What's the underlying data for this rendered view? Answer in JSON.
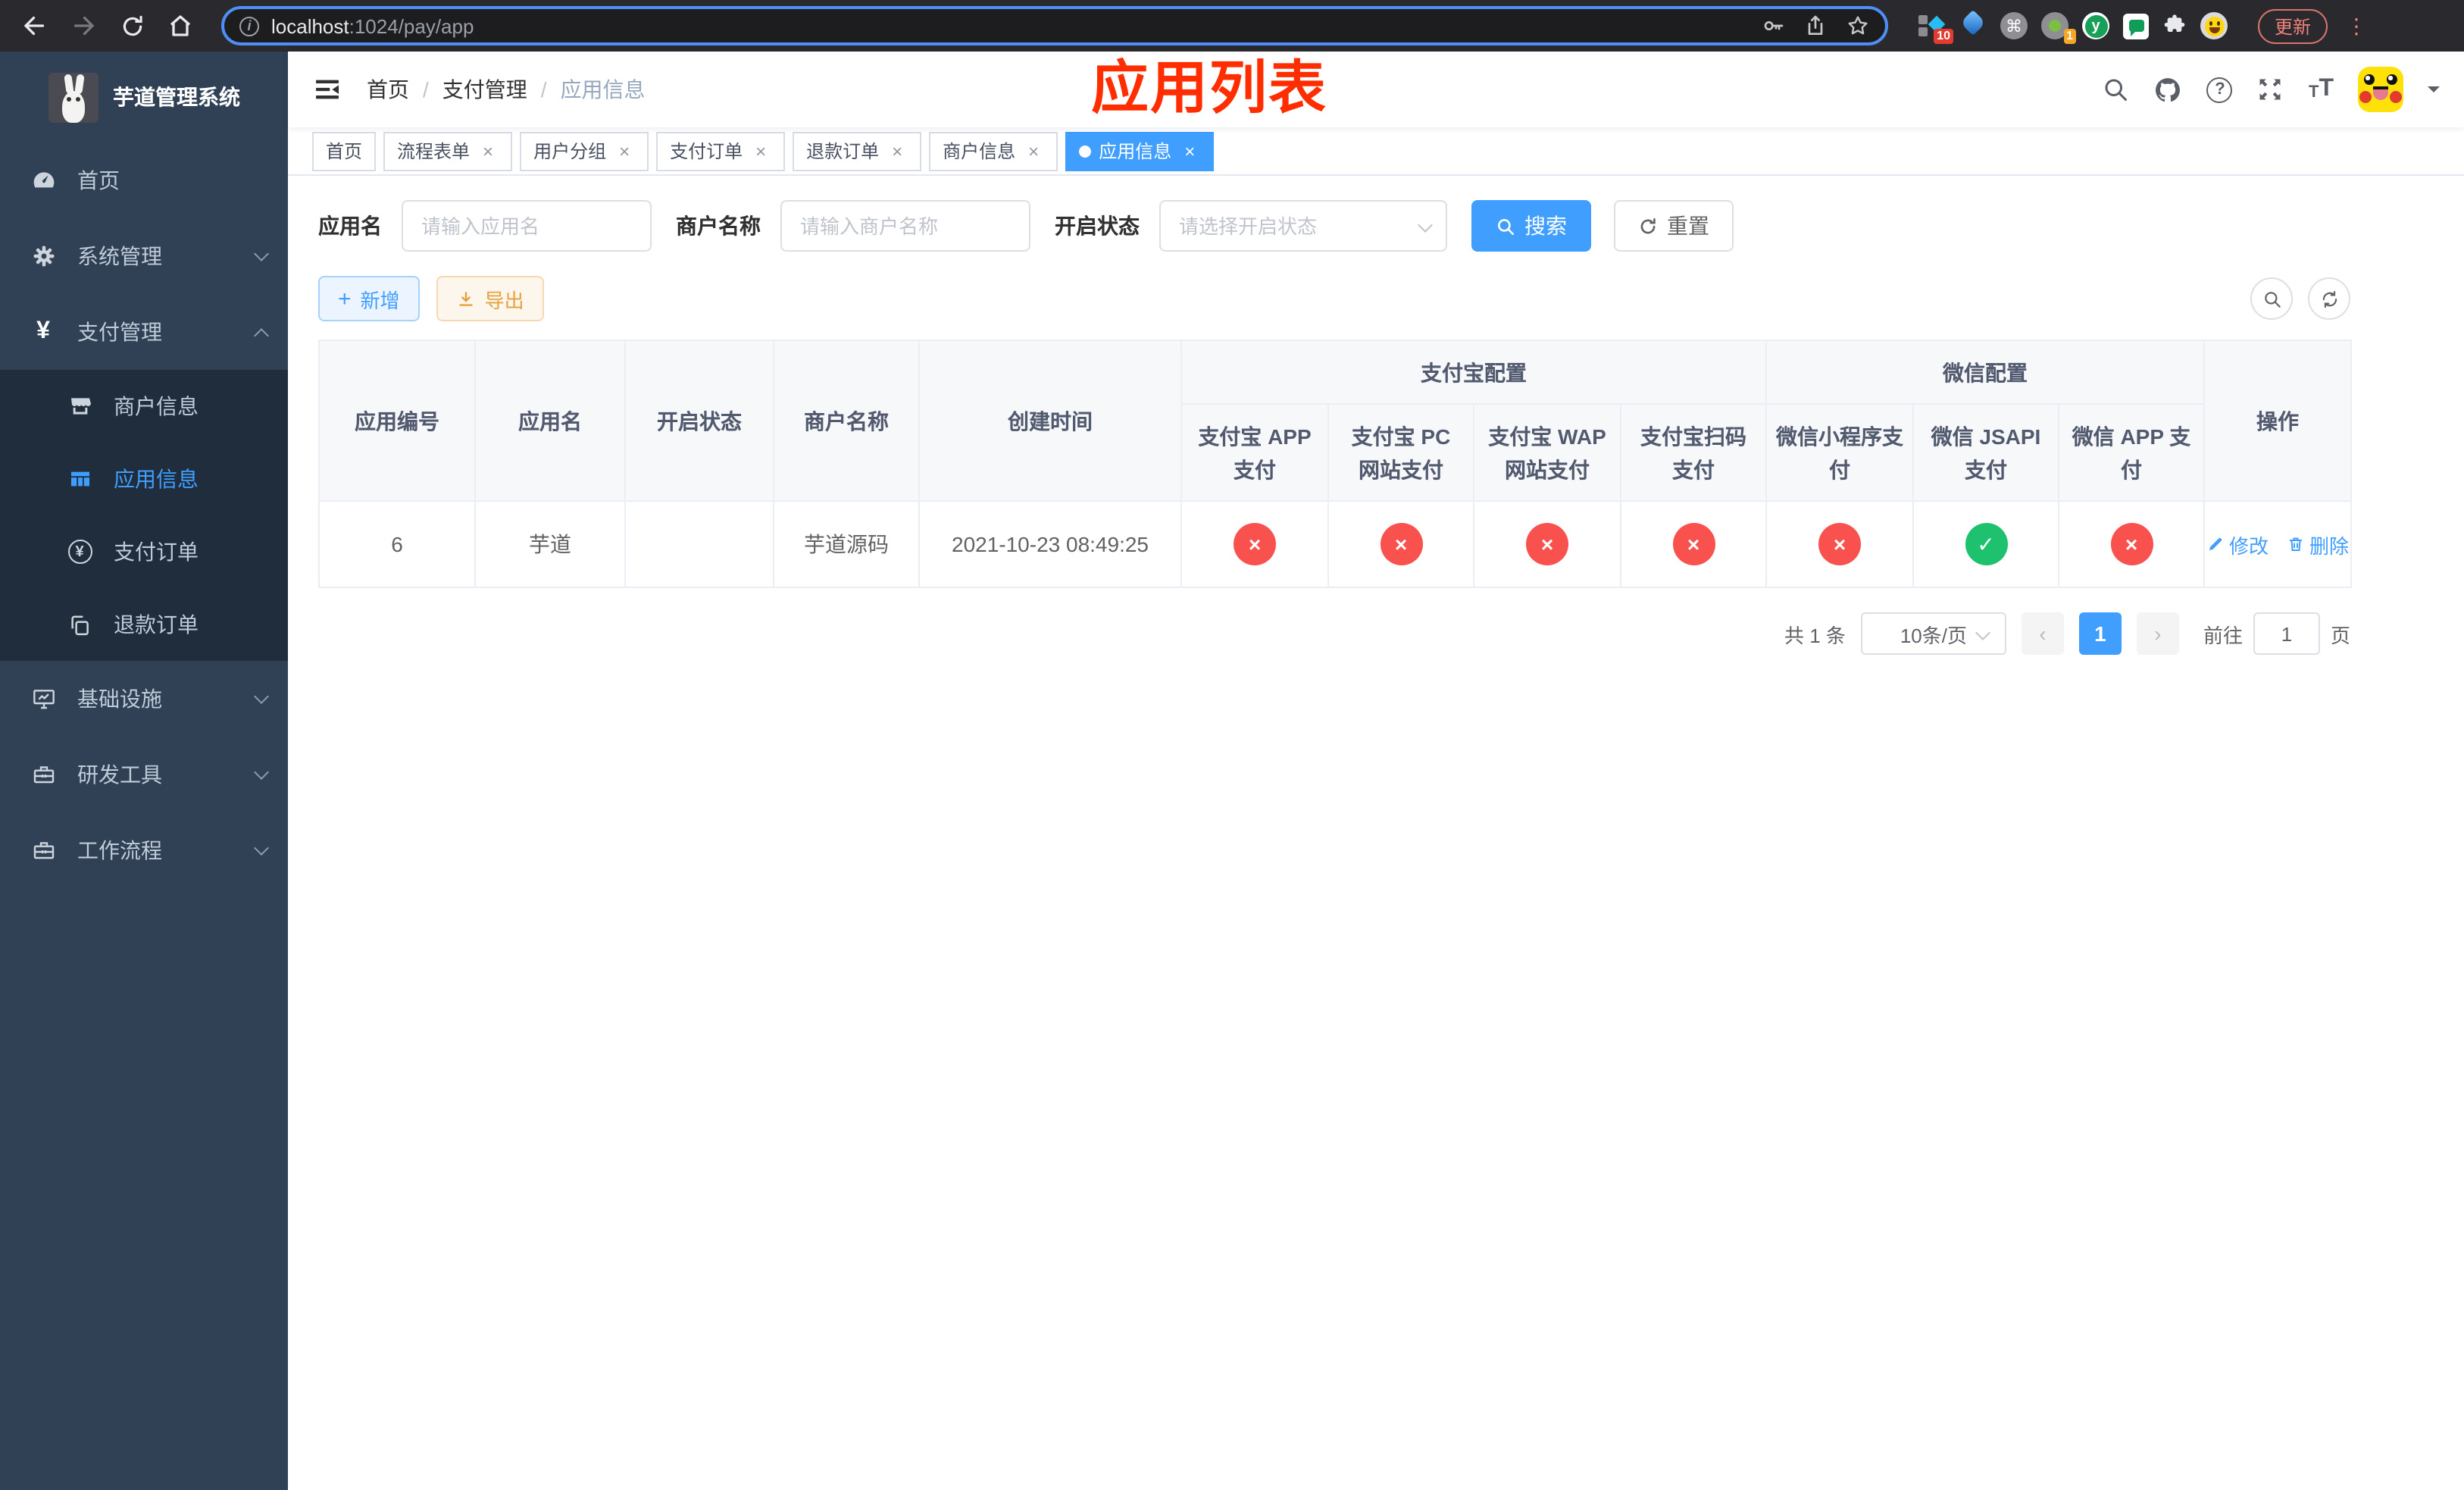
{
  "colors": {
    "accent": "#409EFF",
    "danger": "#F8514E",
    "success": "#1EC26E",
    "warning": "#E6A23C",
    "annotation_red": "#FF2D00",
    "sidebar_bg": "#304156",
    "sidebar_submenu_bg": "#1F2D3D"
  },
  "browser": {
    "url_host": "localhost",
    "url_path": ":1024/pay/app",
    "update_label": "更新",
    "ext_badge_diamond": "10",
    "ext_badge_circle": "1"
  },
  "sidebar": {
    "title": "芋道管理系统",
    "items": [
      {
        "label": "首页"
      },
      {
        "label": "系统管理"
      },
      {
        "label": "支付管理"
      },
      {
        "label": "商户信息"
      },
      {
        "label": "应用信息"
      },
      {
        "label": "支付订单"
      },
      {
        "label": "退款订单"
      },
      {
        "label": "基础设施"
      },
      {
        "label": "研发工具"
      },
      {
        "label": "工作流程"
      }
    ]
  },
  "navbar": {
    "breadcrumb": [
      "首页",
      "支付管理",
      "应用信息"
    ],
    "annotation": "应用列表"
  },
  "tags": [
    {
      "label": "首页"
    },
    {
      "label": "流程表单"
    },
    {
      "label": "用户分组"
    },
    {
      "label": "支付订单"
    },
    {
      "label": "退款订单"
    },
    {
      "label": "商户信息"
    },
    {
      "label": "应用信息"
    }
  ],
  "search": {
    "app_name_label": "应用名",
    "app_name_placeholder": "请输入应用名",
    "merchant_label": "商户名称",
    "merchant_placeholder": "请输入商户名称",
    "status_label": "开启状态",
    "status_placeholder": "请选择开启状态",
    "search_btn": "搜索",
    "reset_btn": "重置"
  },
  "toolbar": {
    "add_label": "新增",
    "export_label": "导出"
  },
  "table": {
    "group_alipay": "支付宝配置",
    "group_wechat": "微信配置",
    "headers": [
      "应用编号",
      "应用名",
      "开启状态",
      "商户名称",
      "创建时间",
      "支付宝 APP 支付",
      "支付宝 PC 网站支付",
      "支付宝 WAP 网站支付",
      "支付宝扫码支付",
      "微信小程序支付",
      "微信 JSAPI 支付",
      "微信 APP 支付",
      "操作"
    ],
    "row": {
      "id": "6",
      "name": "芋道",
      "switch_on": true,
      "merchant": "芋道源码",
      "created": "2021-10-23 08:49:25",
      "statuses": [
        "cross",
        "cross",
        "cross",
        "cross",
        "cross",
        "check",
        "cross"
      ],
      "edit_label": "修改",
      "delete_label": "删除"
    }
  },
  "pagination": {
    "total": "共 1 条",
    "page_size": "10条/页",
    "current": "1",
    "jump_prefix": "前往",
    "jump_suffix": "页",
    "jump_value": "1"
  },
  "ui": {
    "close": "×",
    "cross": "×",
    "check": "✓",
    "sep": "/",
    "question": "?",
    "plus": "+",
    "yen": "¥",
    "prev": "‹",
    "next": "›",
    "letter_T": "T",
    "info": "i",
    "command": "⌘",
    "letter_y": "y",
    "dots": "⋮"
  }
}
